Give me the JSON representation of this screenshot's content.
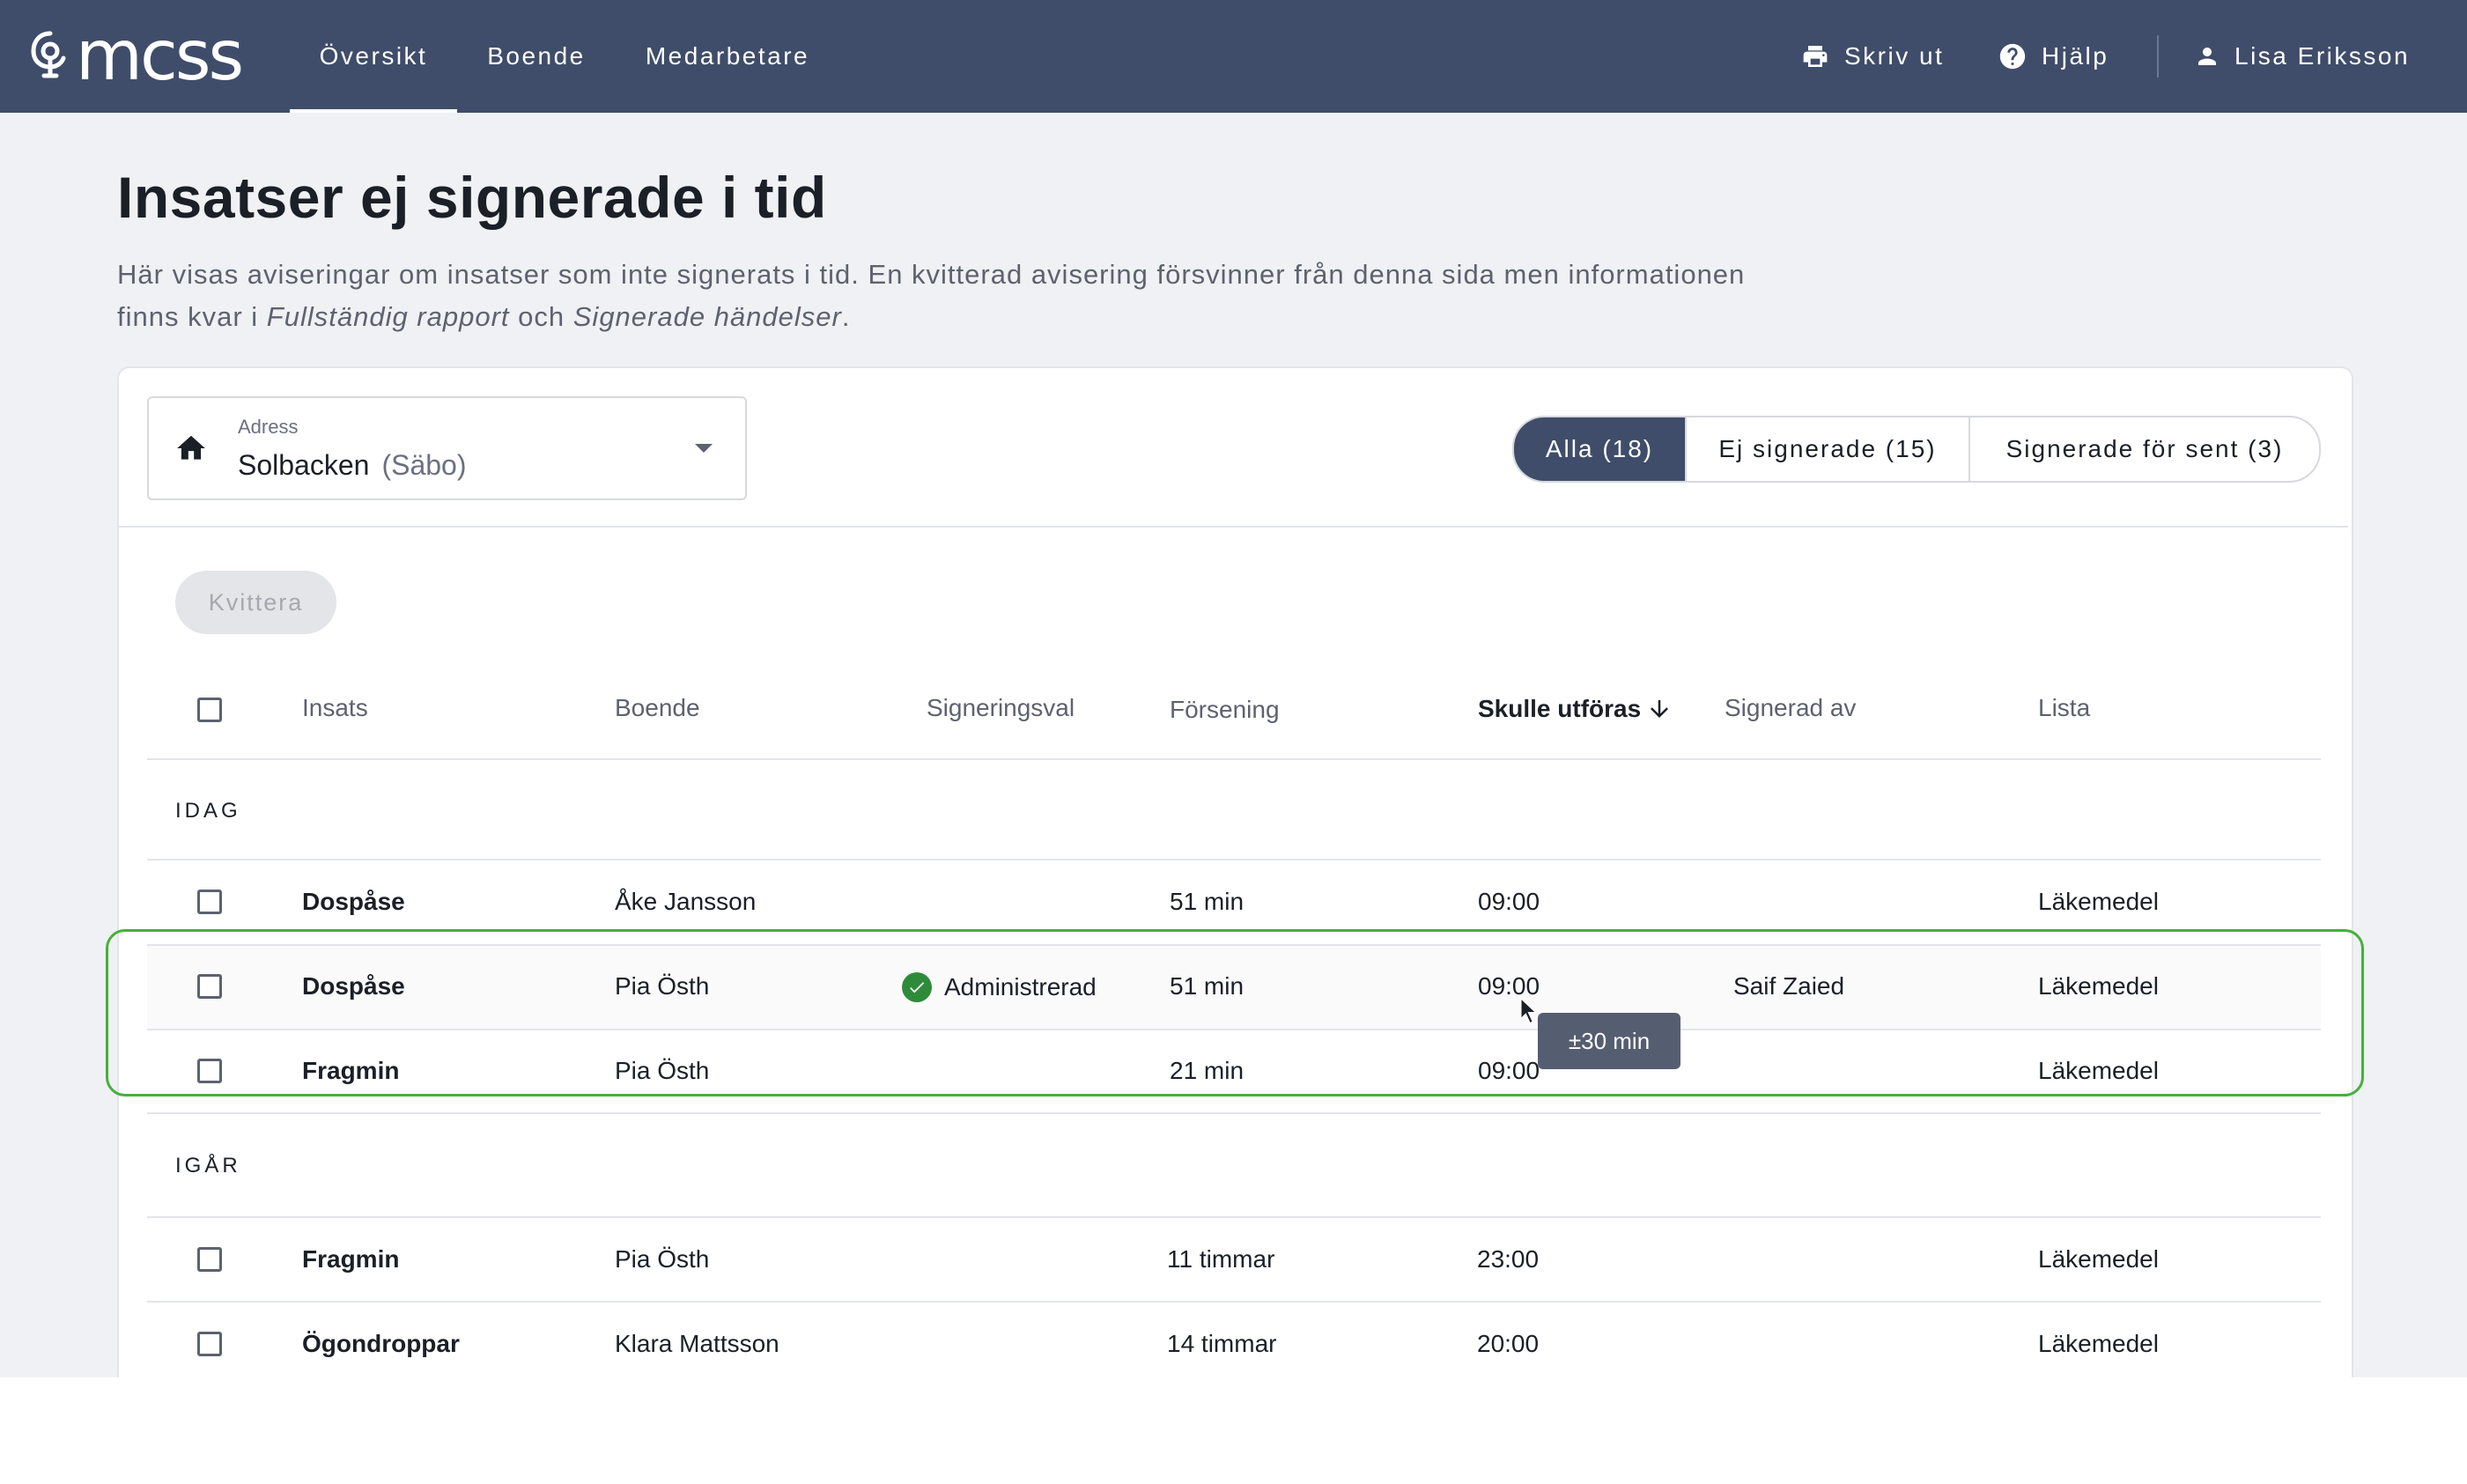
{
  "brand": {
    "logo_text": "mcss"
  },
  "nav": {
    "items": [
      {
        "label": "Översikt",
        "active": true
      },
      {
        "label": "Boende",
        "active": false
      },
      {
        "label": "Medarbetare",
        "active": false
      }
    ],
    "print_label": "Skriv ut",
    "help_label": "Hjälp",
    "user_name": "Lisa Eriksson"
  },
  "page": {
    "title": "Insatser ej signerade i tid",
    "description_part1": "Här visas aviseringar om insatser som inte signerats i tid. En kvitterad avisering försvinner från denna sida men informationen finns kvar i ",
    "description_em1": "Fullständig rapport",
    "description_mid": " och ",
    "description_em2": "Signerade händelser",
    "description_end": "."
  },
  "address": {
    "label": "Adress",
    "value": "Solbacken",
    "sub": "(Säbo)"
  },
  "filters": [
    {
      "label": "Alla (18)",
      "active": true
    },
    {
      "label": "Ej signerade (15)",
      "active": false
    },
    {
      "label": "Signerade för sent (3)",
      "active": false
    }
  ],
  "acknowledge_label": "Kvittera",
  "table": {
    "columns": [
      "Insats",
      "Boende",
      "Signeringsval",
      "Försening",
      "Skulle utföras",
      "Signerad av",
      "Lista"
    ],
    "sorted_column": "Skulle utföras",
    "groups": [
      {
        "label": "IDAG",
        "rows": [
          {
            "insats": "Dospåse",
            "boende": "Åke Jansson",
            "signeringsval": "",
            "forsening": "51 min",
            "tid": "09:00",
            "signerad_av": "",
            "lista": "Läkemedel"
          },
          {
            "insats": "Dospåse",
            "boende": "Pia Östh",
            "signeringsval": "Administrerad",
            "forsening": "51 min",
            "tid": "09:00",
            "signerad_av": "Saif Zaied",
            "lista": "Läkemedel"
          },
          {
            "insats": "Fragmin",
            "boende": "Pia Östh",
            "signeringsval": "",
            "forsening": "21 min",
            "tid": "09:00",
            "signerad_av": "",
            "lista": "Läkemedel"
          }
        ]
      },
      {
        "label": "IGÅR",
        "rows": [
          {
            "insats": "Fragmin",
            "boende": "Pia Östh",
            "signeringsval": "",
            "forsening": "11 timmar",
            "tid": "23:00",
            "signerad_av": "",
            "lista": "Läkemedel"
          },
          {
            "insats": "Ögondroppar",
            "boende": "Klara Mattsson",
            "signeringsval": "",
            "forsening": "14 timmar",
            "tid": "20:00",
            "signerad_av": "",
            "lista": "Läkemedel"
          }
        ]
      }
    ]
  },
  "tooltip": "±30 min",
  "colors": {
    "nav_bg": "#3f4d6a",
    "page_bg": "#f0f1f4",
    "highlight_border": "#46b03a",
    "success": "#2e8b3a"
  }
}
